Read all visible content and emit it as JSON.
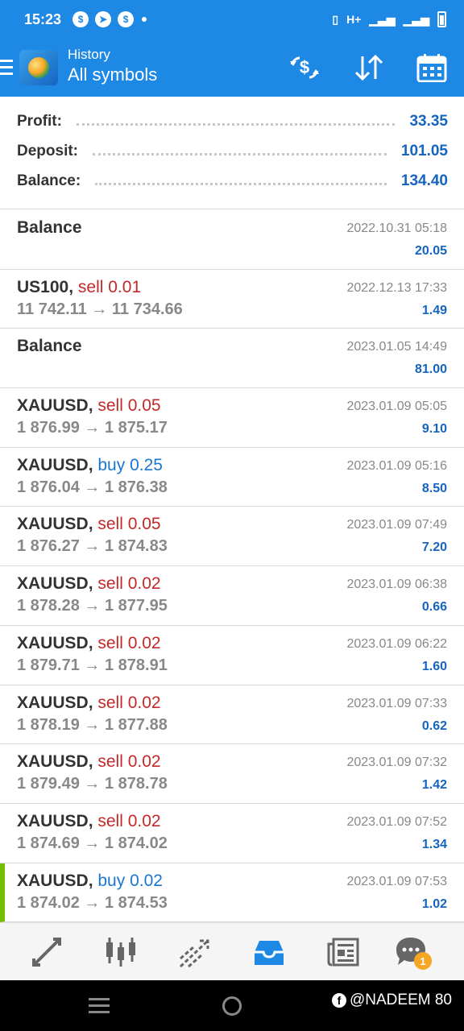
{
  "status_bar": {
    "time": "15:23",
    "network": "H+"
  },
  "app_bar": {
    "subtitle": "History",
    "title": "All symbols"
  },
  "summary": [
    {
      "label": "Profit:",
      "value": "33.35"
    },
    {
      "label": "Deposit:",
      "value": "101.05"
    },
    {
      "label": "Balance:",
      "value": "134.40"
    }
  ],
  "rows": [
    {
      "symbol": "Balance",
      "sep": "",
      "side": "",
      "side_type": "",
      "prices": "",
      "time": "2022.10.31 05:18",
      "profit": "20.05"
    },
    {
      "symbol": "US100",
      "sep": ",",
      "side": "sell 0.01",
      "side_type": "sell",
      "prices": "11 742.11 → 11 734.66",
      "time": "2022.12.13 17:33",
      "profit": "1.49"
    },
    {
      "symbol": "Balance",
      "sep": "",
      "side": "",
      "side_type": "",
      "prices": "",
      "time": "2023.01.05 14:49",
      "profit": "81.00"
    },
    {
      "symbol": "XAUUSD",
      "sep": ",",
      "side": "sell 0.05",
      "side_type": "sell",
      "prices": "1 876.99 → 1 875.17",
      "time": "2023.01.09 05:05",
      "profit": "9.10"
    },
    {
      "symbol": "XAUUSD",
      "sep": ",",
      "side": "buy 0.25",
      "side_type": "buy",
      "prices": "1 876.04 → 1 876.38",
      "time": "2023.01.09 05:16",
      "profit": "8.50"
    },
    {
      "symbol": "XAUUSD",
      "sep": ",",
      "side": "sell 0.05",
      "side_type": "sell",
      "prices": "1 876.27 → 1 874.83",
      "time": "2023.01.09 07:49",
      "profit": "7.20"
    },
    {
      "symbol": "XAUUSD",
      "sep": ",",
      "side": "sell 0.02",
      "side_type": "sell",
      "prices": "1 878.28 → 1 877.95",
      "time": "2023.01.09 06:38",
      "profit": "0.66"
    },
    {
      "symbol": "XAUUSD",
      "sep": ",",
      "side": "sell 0.02",
      "side_type": "sell",
      "prices": "1 879.71 → 1 878.91",
      "time": "2023.01.09 06:22",
      "profit": "1.60"
    },
    {
      "symbol": "XAUUSD",
      "sep": ",",
      "side": "sell 0.02",
      "side_type": "sell",
      "prices": "1 878.19 → 1 877.88",
      "time": "2023.01.09 07:33",
      "profit": "0.62"
    },
    {
      "symbol": "XAUUSD",
      "sep": ",",
      "side": "sell 0.02",
      "side_type": "sell",
      "prices": "1 879.49 → 1 878.78",
      "time": "2023.01.09 07:32",
      "profit": "1.42"
    },
    {
      "symbol": "XAUUSD",
      "sep": ",",
      "side": "sell 0.02",
      "side_type": "sell",
      "prices": "1 874.69 → 1 874.02",
      "time": "2023.01.09 07:52",
      "profit": "1.34"
    },
    {
      "symbol": "XAUUSD",
      "sep": ",",
      "side": "buy 0.02",
      "side_type": "buy",
      "prices": "1 874.02 → 1 874.53",
      "time": "2023.01.09 07:53",
      "profit": "1.02"
    }
  ],
  "tabs": [
    {
      "icon": "quotes-icon"
    },
    {
      "icon": "chart-icon"
    },
    {
      "icon": "trade-icon"
    },
    {
      "icon": "history-icon",
      "active": true
    },
    {
      "icon": "news-icon"
    },
    {
      "icon": "messages-icon",
      "badge": "1"
    }
  ],
  "watermark": "@NADEEM 80",
  "colors": {
    "primary": "#1e88e5",
    "sell": "#c62828",
    "buy": "#1976d2",
    "profit": "#1565c0",
    "selected_marker": "#74c000",
    "badge": "#f5a623"
  }
}
